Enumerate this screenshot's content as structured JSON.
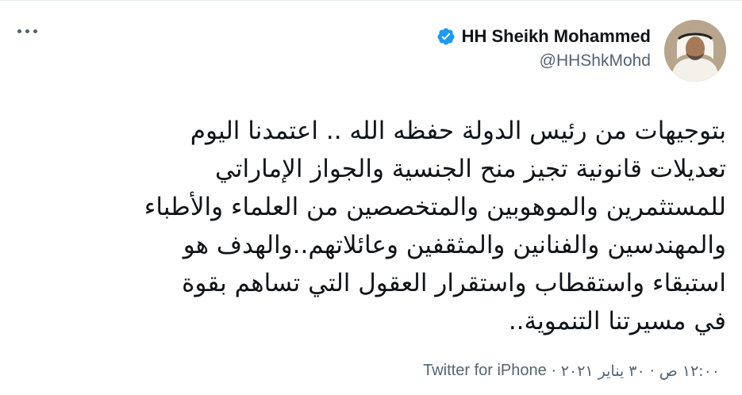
{
  "author": {
    "name": "HH Sheikh Mohammed",
    "handle": "@HHShkMohd"
  },
  "tweet": {
    "text": "بتوجيهات من رئيس الدولة حفظه الله .. اعتمدنا اليوم\nتعديلات قانونية تجيز منح الجنسية والجواز الإماراتي\nللمستثمرين والموهوبين والمتخصصين من العلماء والأطباء\nوالمهندسين والفنانين والمثقفين وعائلاتهم..والهدف هو\nاستبقاء واستقطاب واستقرار العقول التي تساهم بقوة\nفي مسيرتنا التنموية..",
    "time": "١٢:٠٠ ص",
    "separator": "·",
    "date": "٣٠ يناير ٢٠٢١",
    "source": "Twitter for iPhone"
  },
  "colors": {
    "verified": "#1d9bf0",
    "secondary_text": "#536471",
    "primary_text": "#0f1419"
  },
  "icons": {
    "more": "more-dots-icon",
    "verified": "verified-badge-icon",
    "avatar": "profile-photo"
  }
}
